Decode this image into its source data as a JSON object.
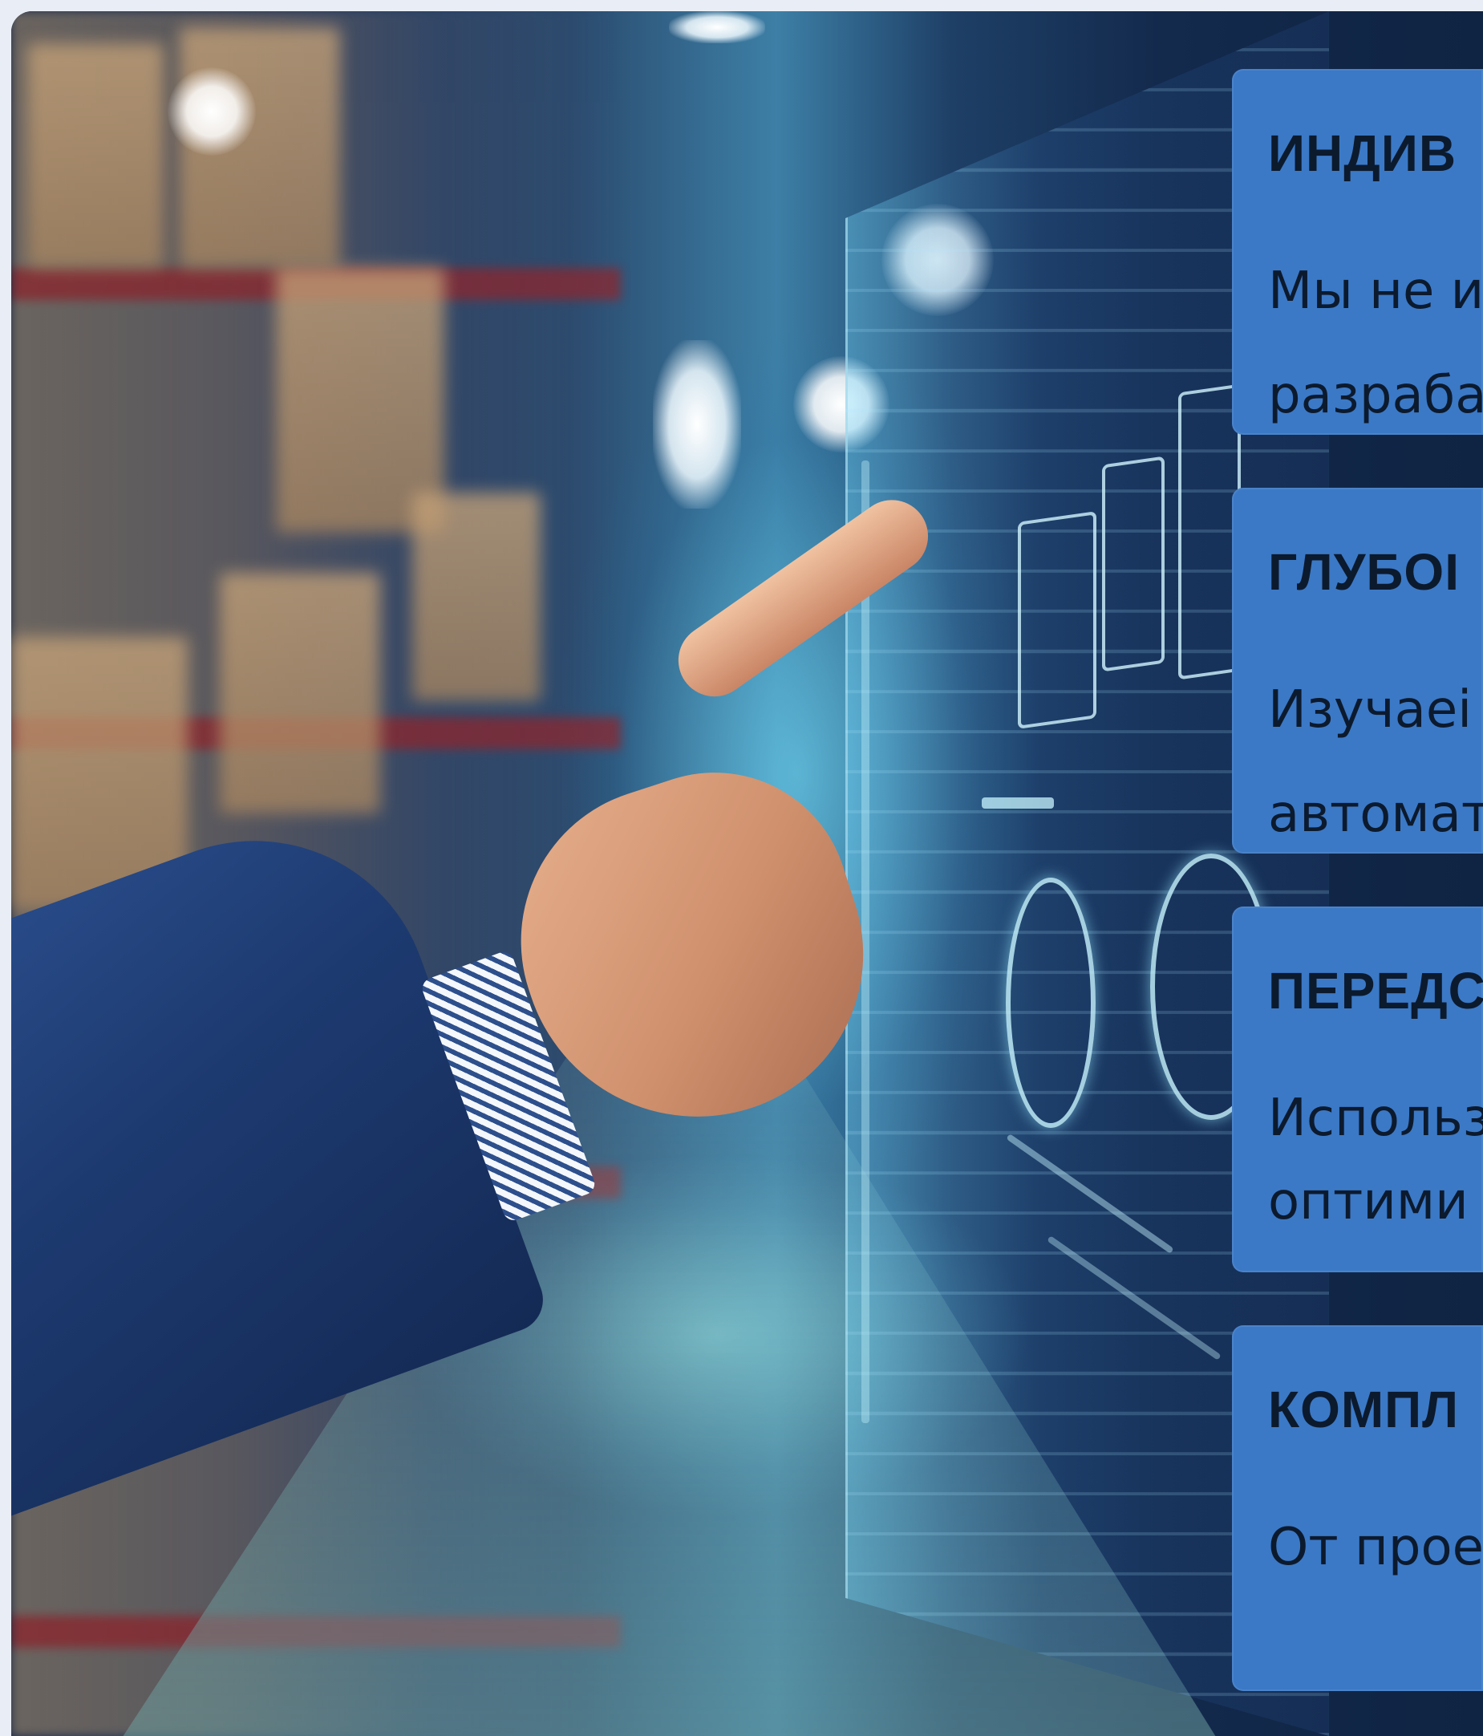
{
  "hero": {
    "image_alt": "Рука указывает на голографический интерфейс на складе"
  },
  "cards": [
    {
      "title": "ИНДИВ",
      "text": "Мы не и\nразраба"
    },
    {
      "title": "ГЛУБОІ",
      "text": "Изучаеі\nавтомат"
    },
    {
      "title": "ПЕРЕДС",
      "text": "Использ\nоптими"
    },
    {
      "title": "КОМПЛ",
      "text": "От прое"
    }
  ],
  "colors": {
    "card_bg": "#3b79c6",
    "card_text": "#0c1a2e",
    "page_bg": "#e9eef6"
  }
}
